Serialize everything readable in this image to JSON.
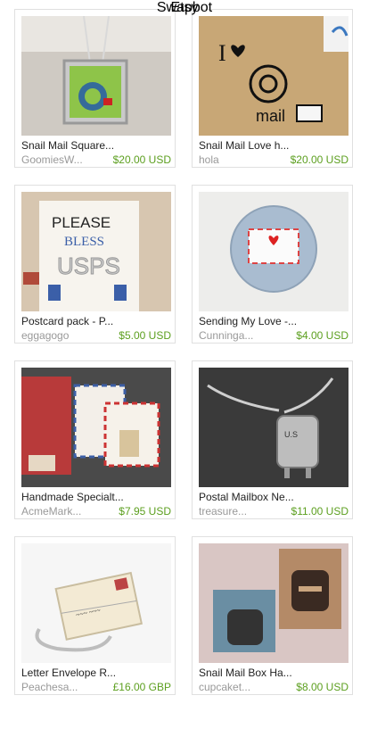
{
  "items": [
    {
      "title": "Snail Mail Square...",
      "shop": "GoomiesW...",
      "price": "$20.00 USD",
      "image": "snail-pendant-image"
    },
    {
      "title": "Snail Mail Love h...",
      "shop": "hola",
      "price": "$20.00 USD",
      "image": "i-love-mail-stamp-image"
    },
    {
      "title": "Postcard pack - P...",
      "shop": "eggagogo",
      "price": "$5.00 USD",
      "image": "please-bless-usps-postcard-image"
    },
    {
      "title": "Sending My Love -...",
      "shop": "Cunninga...",
      "price": "$4.00 USD",
      "image": "love-letter-button-image"
    },
    {
      "title": "Handmade Specialt...",
      "shop": "AcmeMark...",
      "price": "$7.95 USD",
      "image": "airmail-stationery-image"
    },
    {
      "title": "Postal Mailbox Ne...",
      "shop": "treasure...",
      "price": "$11.00 USD",
      "image": "mailbox-necklace-image"
    },
    {
      "title": "Letter Envelope R...",
      "shop": "Peachesa...",
      "price": "£16.00 GBP",
      "image": "envelope-ring-image"
    },
    {
      "title": "Snail Mail Box Ha...",
      "shop": "cupcaket...",
      "price": "$8.00 USD",
      "image": "snail-mailbox-stamp-image"
    }
  ],
  "footer": {
    "brand": "Etsy",
    "sub": "Swapbot"
  },
  "colors": {
    "price": "#5c9f1f",
    "shop": "#999999",
    "link": "#1a73b8",
    "border": "#e0e0e0"
  }
}
